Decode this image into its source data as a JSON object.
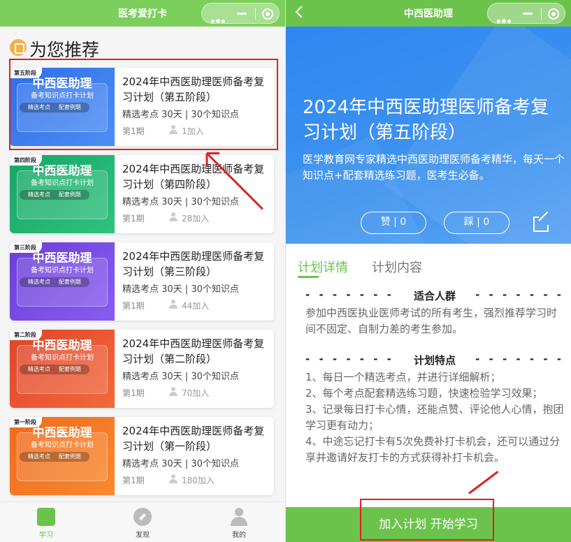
{
  "left": {
    "nav_title": "医考爱打卡",
    "section_title": "为您推荐",
    "cards": [
      {
        "stage": "第五阶段",
        "thumb_title": "中西医助理",
        "thumb_sub": "备考知识点打卡计划",
        "tag1": "精选考点",
        "tag2": "配套例题",
        "title": "2024年中西医助理医师备考复习计划（第五阶段）",
        "meta": "精选考点  30天 | 30个知识点",
        "period": "第1期",
        "join": "1加入",
        "color_a": "#2f6ee8",
        "color_b": "#4c8ef4"
      },
      {
        "stage": "第四阶段",
        "thumb_title": "中西医助理",
        "thumb_sub": "备考知识点打卡计划",
        "tag1": "精选考点",
        "tag2": "配套例题",
        "title": "2024年中西医助理医师备考复习计划（第四阶段）",
        "meta": "精选考点  30天 | 30个知识点",
        "period": "第1期",
        "join": "28加入",
        "color_a": "#17a566",
        "color_b": "#2fc37e"
      },
      {
        "stage": "第三阶段",
        "thumb_title": "中西医助理",
        "thumb_sub": "备考知识点打卡计划",
        "tag1": "精选考点",
        "tag2": "配套例题",
        "title": "2024年中西医助理医师备考复习计划（第三阶段）",
        "meta": "精选考点  30天 | 30个知识点",
        "period": "第1期",
        "join": "44加入",
        "color_a": "#6a3fd8",
        "color_b": "#8a5cf0"
      },
      {
        "stage": "第二阶段",
        "thumb_title": "中西医助理",
        "thumb_sub": "备考知识点打卡计划",
        "tag1": "精选考点",
        "tag2": "配套例题",
        "title": "2024年中西医助理医师备考复习计划（第二阶段）",
        "meta": "精选考点  30天 | 30个知识点",
        "period": "第1期",
        "join": "70加入",
        "color_a": "#e0432a",
        "color_b": "#f26a3c"
      },
      {
        "stage": "第一阶段",
        "thumb_title": "中西医助理",
        "thumb_sub": "备考知识点打卡计划",
        "tag1": "精选考点",
        "tag2": "配套例题",
        "title": "2024年中西医助理医师备考复习计划（第一阶段）",
        "meta": "精选考点  30天 | 30个知识点",
        "period": "第1期",
        "join": "180加入",
        "color_a": "#f06a1c",
        "color_b": "#f88a30"
      }
    ],
    "tabbar": {
      "study": "学习",
      "discover": "发现",
      "mine": "我的"
    }
  },
  "right": {
    "nav_title": "中西医助理",
    "hero_title": "2024年中西医助理医师备考复习计划（第五阶段）",
    "hero_desc": "医学教育网专家精选中西医助理医师备考精华，每天一个知识点+配套精选练习题，医考生必备。",
    "like": "赞 | 0",
    "dislike": "踩 | 0",
    "tab_detail": "计划详情",
    "tab_content": "计划内容",
    "section1_title": "适合人群",
    "section1_text": "参加中西医执业医师考试的所有考生，强烈推荐学习时间不固定、自制力差的考生参加。",
    "section2_title": "计划特点",
    "features": [
      "1、每日一个精选考点，并进行详细解析；",
      "2、每个考点配套精选练习题，快速检验学习效果；",
      "3、记录每日打卡心情，还能点赞、评论他人心情，抱团学习更有动力；",
      "4、中途忘记打卡有5次免费补打卡机会，还可以通过分享并邀请好友打卡的方式获得补打卡机会。"
    ],
    "join_button": "加入计划 开始学习"
  },
  "colors": {
    "green": "#6cc34c",
    "blue": "#2e86f0",
    "red_annotation": "#e02020"
  }
}
